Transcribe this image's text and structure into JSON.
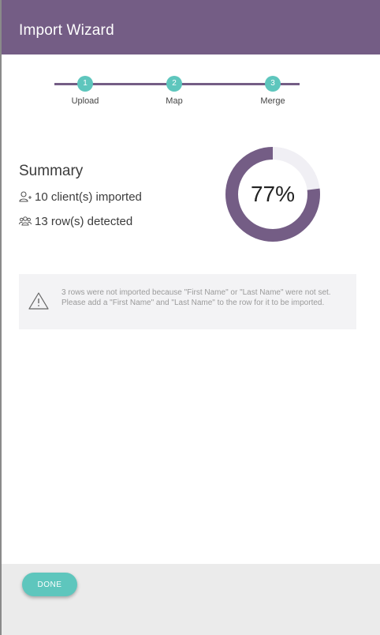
{
  "header": {
    "title": "Import Wizard"
  },
  "stepper": {
    "steps": [
      {
        "number": "1",
        "label": "Upload"
      },
      {
        "number": "2",
        "label": "Map"
      },
      {
        "number": "3",
        "label": "Merge"
      }
    ]
  },
  "summary": {
    "title": "Summary",
    "imported_text": "10 client(s) imported",
    "detected_text": "13 row(s) detected",
    "imported_icon": "add-user-icon",
    "detected_icon": "users-group-icon"
  },
  "progress": {
    "percent_label": "77%",
    "value": 0.77
  },
  "warning": {
    "icon": "warning-triangle-icon",
    "text": "3 rows were not imported because \"First Name\" or \"Last Name\" were not set. Please add a \"First Name\" and \"Last Name\" to the row for it to be imported."
  },
  "footer": {
    "done_label": "DONE"
  },
  "colors": {
    "primary": "#745d85",
    "accent": "#5ec6bd",
    "track": "#f0eff4"
  }
}
